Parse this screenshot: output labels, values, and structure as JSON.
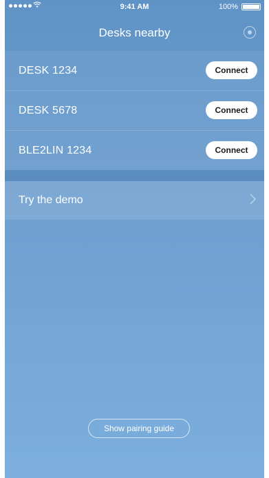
{
  "status_bar": {
    "time": "9:41 AM",
    "battery": "100%",
    "wifi_icon": "wifi-icon"
  },
  "nav": {
    "title": "Desks nearby",
    "action_icon": "target-icon"
  },
  "desks": [
    {
      "name": "DESK 1234",
      "action": "Connect"
    },
    {
      "name": "DESK 5678",
      "action": "Connect"
    },
    {
      "name": "BLE2LIN 1234",
      "action": "Connect"
    }
  ],
  "demo": {
    "label": "Try the demo",
    "icon": "chevron-right-icon"
  },
  "footer": {
    "pairing_label": "Show pairing guide"
  }
}
